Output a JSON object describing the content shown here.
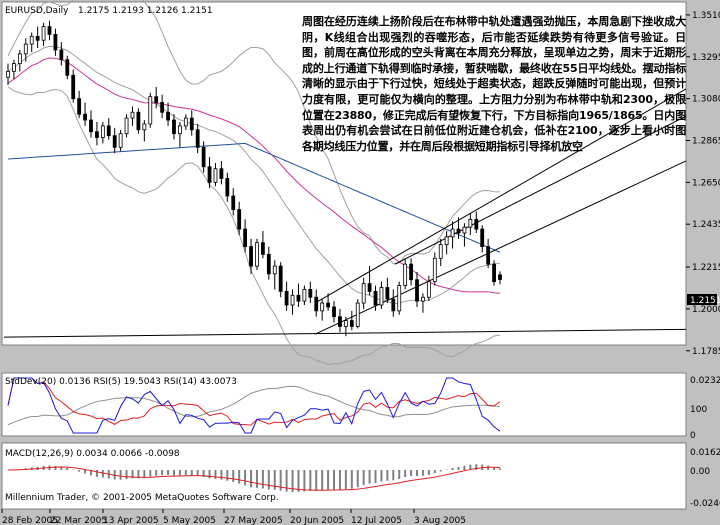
{
  "header": {
    "symbol": "EURUSD,Daily",
    "ohlc": "1.2175  1.2193  1.2126  1.2151"
  },
  "annotation_text": "周图在经历连续上扬阶段后在布林带中轨处遭遇强劲抛压，本周急剧下挫收成大阴，K线组合出现强烈的吞噬形态，后市能否延续跌势有待更多信号验证。日图，前周在高位形成的空头背离在本周充分释放，呈现单边之势，周末于近期形成的上行通道下轨得到临时承接，暂获喘歇，最终收在55日平均线处。摆动指标清晰的显示由于下行过快，短线处于超卖状态，超跌反弹随时可能出现，但预计力度有限，更可能仅为横向的整理。上方阻力分别为布林带中轨和2300，极限位置在23880，修正完成后有望恢复下行，下方目标指向1965/1865。日内图表周出仍有机会尝试在日前低位附近建仓机会，低补在2100，逐步上看小时图各期均线压力位置，并在周后段根据短期指标引导择机放空",
  "indicator_panel": {
    "label": "StdDev(20) 0.0136  RSI(5) 19.5043  RSI(14) 43.0073",
    "ticks": [
      "0.0232",
      "100",
      "0"
    ]
  },
  "macd_panel": {
    "label": "MACD(12,26,9) 0.0034 0.0066 -0.0098",
    "ticks": [
      "0.0162",
      "0.00",
      "-0.0246"
    ],
    "copyright": "Millennium Trader, © 2001-2005 MetaQuotes Software Corp."
  },
  "colors": {
    "background": "#c0c0c0",
    "plot_bg": "#ffffff",
    "candle_body": "#000000",
    "bollinger": "#a0a0a0",
    "ma_55": "#cc3399",
    "ma_long": "#1f4fa0",
    "stddev": "#1a1ad6",
    "rsi5": "#e02020",
    "rsi14": "#909090",
    "macd_hist": "#808080",
    "macd_signal": "#e02020",
    "current_price_bg": "#000000"
  },
  "chart_data": {
    "type": "candlestick",
    "ylim": [
      1.183,
      1.3525
    ],
    "y_ticks": [
      "1.3510",
      "1.3295",
      "1.3080",
      "1.2865",
      "1.2650",
      "1.2435",
      "1.2215",
      "1.2000",
      "1.1785"
    ],
    "current_price": "1.2151",
    "x_ticks": [
      "28 Feb 2005",
      "22 Mar 2005",
      "13 Apr 2005",
      "5 May 2005",
      "27 May 2005",
      "20 Jun 2005",
      "12 Jul 2005",
      "3 Aug 2005"
    ],
    "candles": [
      [
        1.319,
        1.326,
        1.315,
        1.322
      ],
      [
        1.322,
        1.328,
        1.318,
        1.326
      ],
      [
        1.326,
        1.333,
        1.322,
        1.331
      ],
      [
        1.331,
        1.339,
        1.327,
        1.336
      ],
      [
        1.336,
        1.342,
        1.332,
        1.34
      ],
      [
        1.34,
        1.345,
        1.334,
        1.338
      ],
      [
        1.338,
        1.347,
        1.335,
        1.345
      ],
      [
        1.345,
        1.348,
        1.338,
        1.341
      ],
      [
        1.341,
        1.344,
        1.33,
        1.333
      ],
      [
        1.333,
        1.337,
        1.325,
        1.328
      ],
      [
        1.328,
        1.33,
        1.318,
        1.32
      ],
      [
        1.32,
        1.323,
        1.306,
        1.308
      ],
      [
        1.308,
        1.312,
        1.298,
        1.3
      ],
      [
        1.3,
        1.306,
        1.294,
        1.297
      ],
      [
        1.297,
        1.302,
        1.288,
        1.291
      ],
      [
        1.291,
        1.296,
        1.284,
        1.288
      ],
      [
        1.288,
        1.296,
        1.285,
        1.294
      ],
      [
        1.294,
        1.298,
        1.287,
        1.289
      ],
      [
        1.289,
        1.293,
        1.28,
        1.283
      ],
      [
        1.283,
        1.292,
        1.281,
        1.29
      ],
      [
        1.29,
        1.3,
        1.288,
        1.298
      ],
      [
        1.298,
        1.304,
        1.294,
        1.301
      ],
      [
        1.301,
        1.303,
        1.29,
        1.292
      ],
      [
        1.292,
        1.297,
        1.286,
        1.295
      ],
      [
        1.295,
        1.311,
        1.293,
        1.309
      ],
      [
        1.309,
        1.314,
        1.303,
        1.306
      ],
      [
        1.306,
        1.31,
        1.298,
        1.301
      ],
      [
        1.301,
        1.306,
        1.294,
        1.297
      ],
      [
        1.297,
        1.3,
        1.287,
        1.29
      ],
      [
        1.29,
        1.296,
        1.283,
        1.294
      ],
      [
        1.294,
        1.3,
        1.292,
        1.298
      ],
      [
        1.298,
        1.302,
        1.289,
        1.292
      ],
      [
        1.292,
        1.295,
        1.28,
        1.283
      ],
      [
        1.283,
        1.286,
        1.27,
        1.273
      ],
      [
        1.273,
        1.278,
        1.262,
        1.265
      ],
      [
        1.265,
        1.275,
        1.263,
        1.272
      ],
      [
        1.272,
        1.276,
        1.264,
        1.267
      ],
      [
        1.267,
        1.27,
        1.255,
        1.258
      ],
      [
        1.258,
        1.262,
        1.248,
        1.251
      ],
      [
        1.251,
        1.255,
        1.238,
        1.241
      ],
      [
        1.241,
        1.246,
        1.229,
        1.232
      ],
      [
        1.232,
        1.236,
        1.218,
        1.222
      ],
      [
        1.222,
        1.236,
        1.22,
        1.234
      ],
      [
        1.234,
        1.24,
        1.226,
        1.228
      ],
      [
        1.228,
        1.232,
        1.215,
        1.218
      ],
      [
        1.218,
        1.225,
        1.21,
        1.222
      ],
      [
        1.222,
        1.224,
        1.206,
        1.209
      ],
      [
        1.209,
        1.214,
        1.199,
        1.202
      ],
      [
        1.202,
        1.21,
        1.197,
        1.207
      ],
      [
        1.207,
        1.213,
        1.201,
        1.204
      ],
      [
        1.204,
        1.212,
        1.202,
        1.21
      ],
      [
        1.21,
        1.214,
        1.203,
        1.206
      ],
      [
        1.206,
        1.21,
        1.196,
        1.199
      ],
      [
        1.199,
        1.205,
        1.194,
        1.203
      ],
      [
        1.203,
        1.208,
        1.199,
        1.201
      ],
      [
        1.201,
        1.204,
        1.193,
        1.196
      ],
      [
        1.196,
        1.2,
        1.188,
        1.191
      ],
      [
        1.191,
        1.196,
        1.186,
        1.194
      ],
      [
        1.194,
        1.199,
        1.189,
        1.191
      ],
      [
        1.191,
        1.205,
        1.19,
        1.203
      ],
      [
        1.203,
        1.216,
        1.2,
        1.213
      ],
      [
        1.213,
        1.222,
        1.207,
        1.209
      ],
      [
        1.209,
        1.212,
        1.199,
        1.202
      ],
      [
        1.202,
        1.214,
        1.2,
        1.211
      ],
      [
        1.211,
        1.216,
        1.203,
        1.205
      ],
      [
        1.205,
        1.21,
        1.196,
        1.199
      ],
      [
        1.199,
        1.214,
        1.197,
        1.212
      ],
      [
        1.212,
        1.226,
        1.21,
        1.223
      ],
      [
        1.223,
        1.226,
        1.212,
        1.215
      ],
      [
        1.215,
        1.219,
        1.201,
        1.204
      ],
      [
        1.204,
        1.208,
        1.198,
        1.206
      ],
      [
        1.206,
        1.217,
        1.204,
        1.214
      ],
      [
        1.214,
        1.229,
        1.212,
        1.226
      ],
      [
        1.226,
        1.236,
        1.222,
        1.233
      ],
      [
        1.233,
        1.24,
        1.228,
        1.237
      ],
      [
        1.237,
        1.245,
        1.231,
        1.241
      ],
      [
        1.241,
        1.247,
        1.236,
        1.239
      ],
      [
        1.239,
        1.244,
        1.232,
        1.242
      ],
      [
        1.242,
        1.249,
        1.238,
        1.246
      ],
      [
        1.246,
        1.25,
        1.239,
        1.241
      ],
      [
        1.241,
        1.243,
        1.229,
        1.232
      ],
      [
        1.232,
        1.236,
        1.221,
        1.223
      ],
      [
        1.223,
        1.225,
        1.212,
        1.214
      ],
      [
        1.2175,
        1.2193,
        1.2126,
        1.2151
      ]
    ]
  }
}
